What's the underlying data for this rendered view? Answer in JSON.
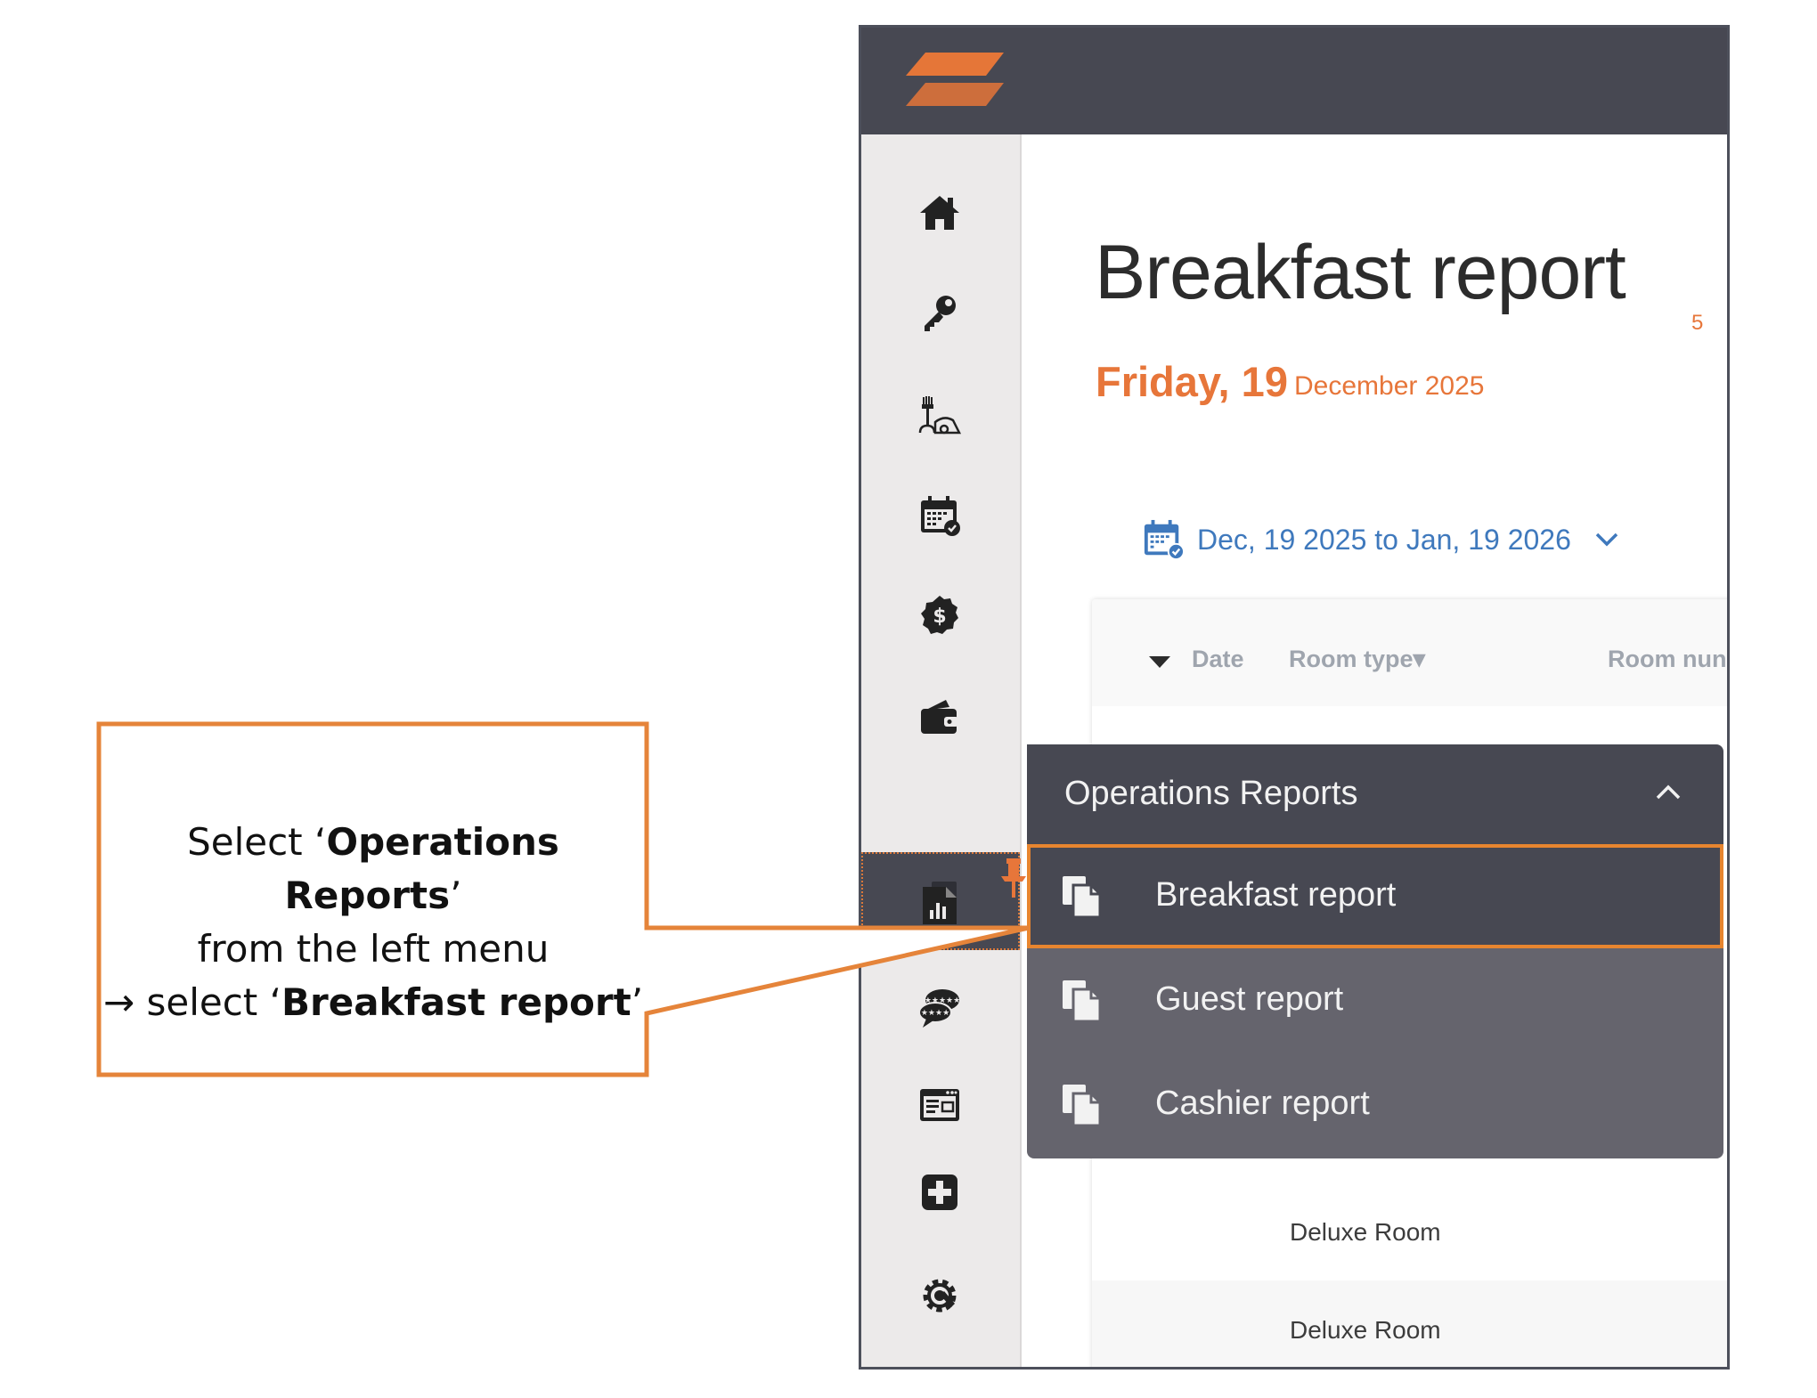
{
  "report": {
    "title": "Breakfast report",
    "day": "Friday, 19",
    "month_year": "December 2025",
    "date_range": "Dec, 19 2025 to Jan, 19 2026"
  },
  "table": {
    "columns": [
      "Date",
      "Room type▾",
      "Room nun"
    ],
    "rows": [
      "Deluxe Room",
      "Deluxe Room"
    ],
    "partial_value": "5"
  },
  "sidebar": {
    "icons": [
      "home-icon",
      "key-icon",
      "housekeeping-icon",
      "calendar-icon",
      "dollar-icon",
      "wallet-icon",
      "operations-reports-icon",
      "reports-chart-icon",
      "reviews-icon",
      "channel-icon",
      "add-icon",
      "settings-icon"
    ]
  },
  "menu": {
    "title": "Operations Reports",
    "items": [
      "Breakfast report",
      "Guest report",
      "Cashier report"
    ]
  },
  "callout": {
    "prefix": "Select ‘",
    "ops": "Operations Reports",
    "q1": "’",
    "line2": "from the left menu",
    "arrow": "→ select ‘",
    "breakfast": "Breakfast report",
    "q2": "’"
  },
  "colors": {
    "accent": "#e7763a",
    "topbar": "#474852",
    "link": "#3f79bd",
    "menu_body": "#65646d"
  }
}
